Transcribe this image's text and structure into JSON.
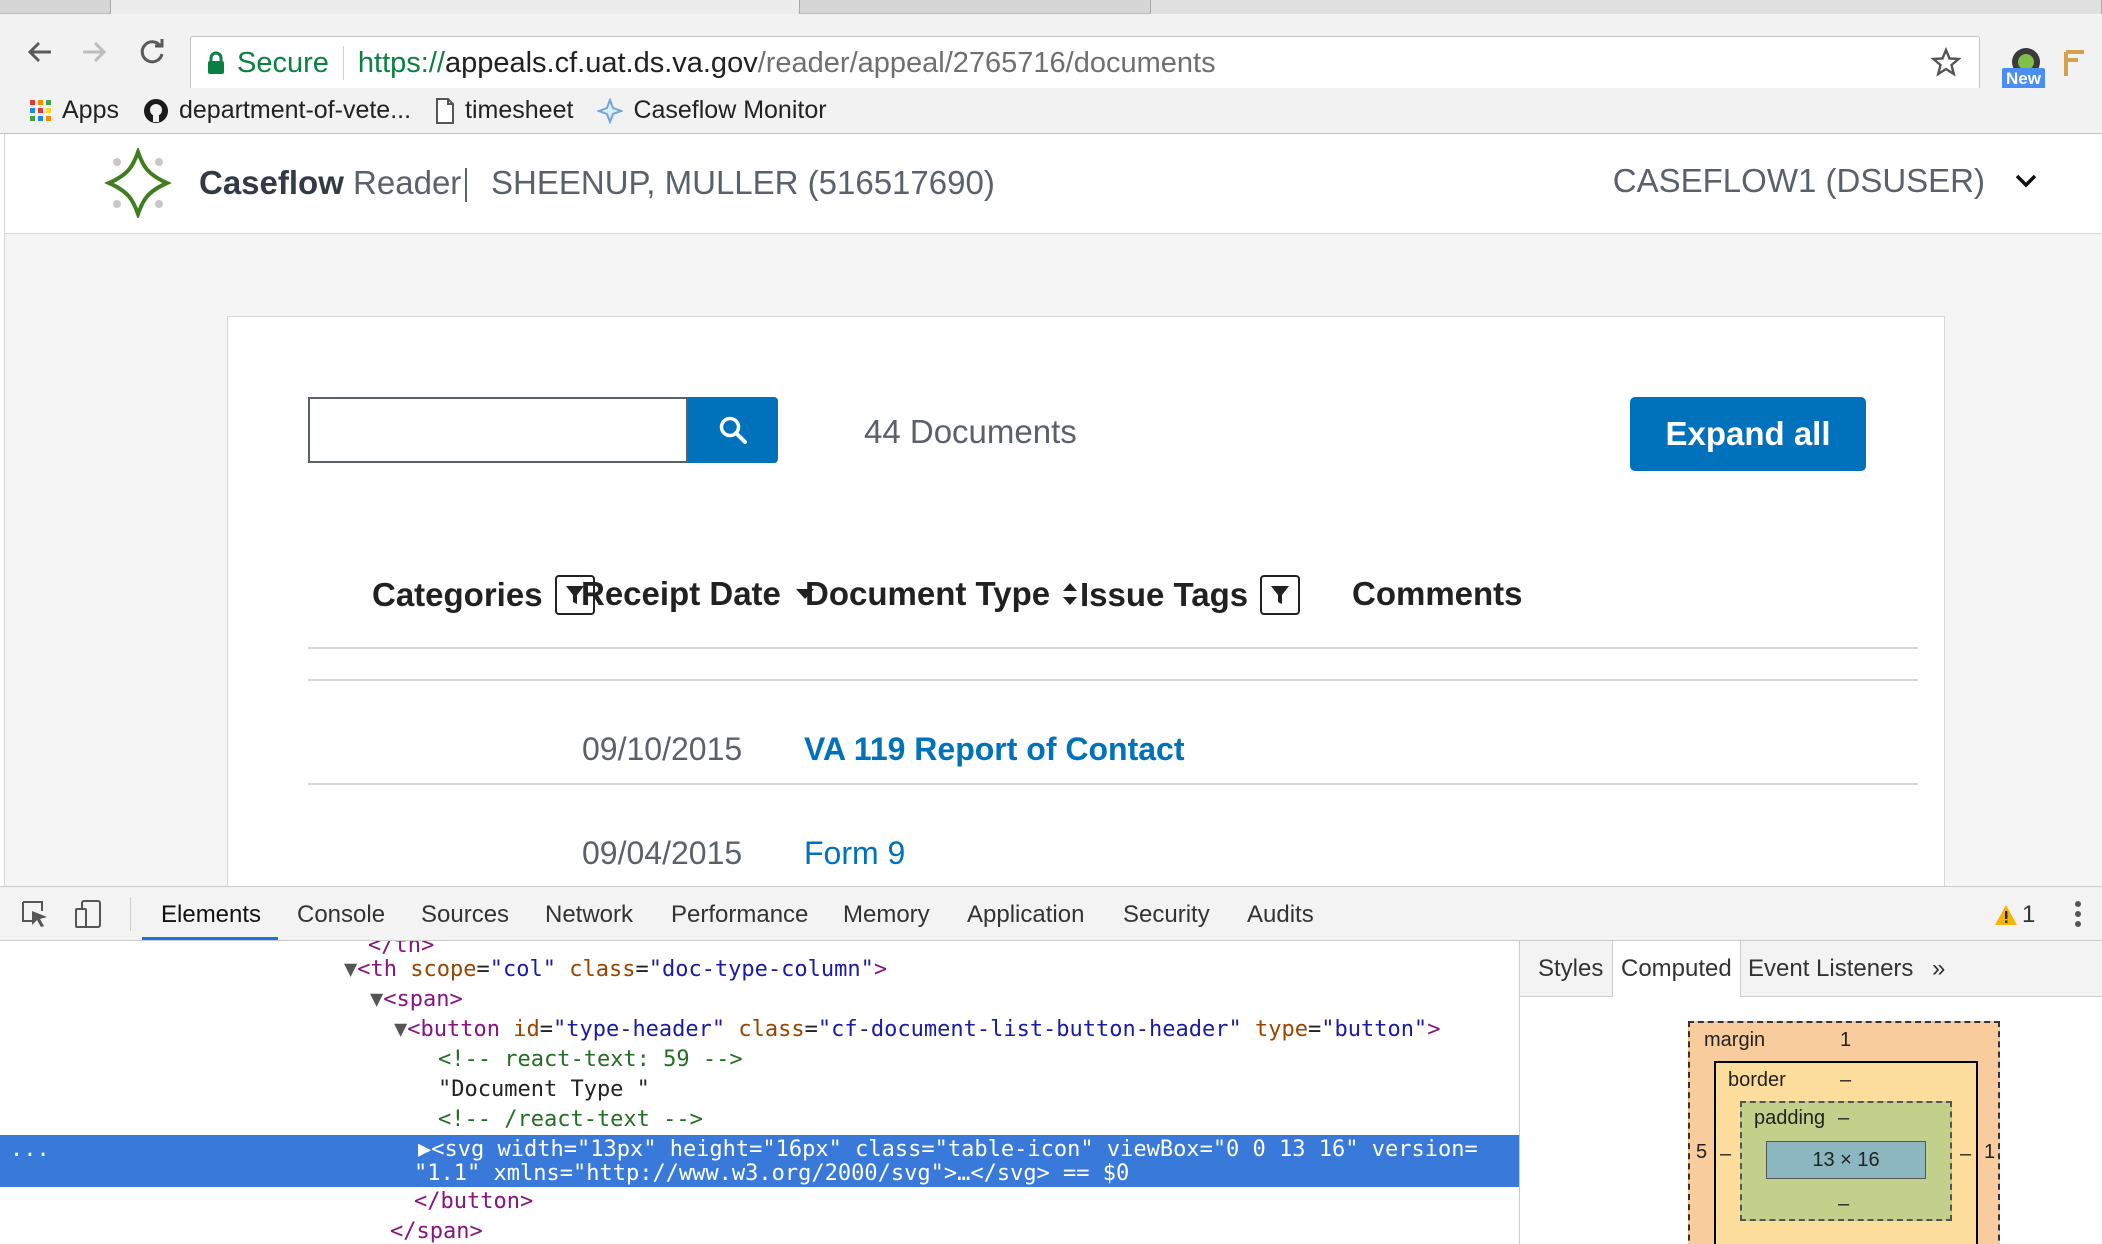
{
  "browser": {
    "address": {
      "secure_label": "Secure",
      "scheme": "https://",
      "host": "appeals.cf.uat.ds.va.gov",
      "path": "/reader/appeal/2765716/documents"
    },
    "extension_badge": "New",
    "bookmarks": [
      {
        "label": "Apps",
        "icon": "apps-grid-icon"
      },
      {
        "label": "department-of-vete...",
        "icon": "github-icon"
      },
      {
        "label": "timesheet",
        "icon": "page-icon"
      },
      {
        "label": "Caseflow Monitor",
        "icon": "caseflow-icon"
      }
    ]
  },
  "app": {
    "name_bold": "Caseflow",
    "name_light": "Reader",
    "veteran": "SHEENUP, MULLER (516517690)",
    "user": "CASEFLOW1 (DSUSER)"
  },
  "documents": {
    "count_label": "44 Documents",
    "expand_all_label": "Expand all",
    "columns": {
      "categories": "Categories",
      "receipt_date": "Receipt Date",
      "document_type": "Document Type",
      "issue_tags": "Issue Tags",
      "comments": "Comments"
    },
    "rows": [
      {
        "date": "09/10/2015",
        "type": "VA 119 Report of Contact",
        "bold": true
      },
      {
        "date": "09/04/2015",
        "type": "Form 9",
        "bold": false
      }
    ]
  },
  "devtools": {
    "tabs": [
      "Elements",
      "Console",
      "Sources",
      "Network",
      "Performance",
      "Memory",
      "Application",
      "Security",
      "Audits"
    ],
    "active_tab": "Elements",
    "warning_count": "1",
    "side_tabs": {
      "styles": "Styles",
      "computed": "Computed",
      "listeners": "Event Listeners",
      "more": "»"
    },
    "box_model": {
      "margin_label": "margin",
      "margin_top": "1",
      "margin_left": "5",
      "margin_right": "1",
      "border_label": "border",
      "border_top": "–",
      "padding_label": "padding",
      "padding_top": "–",
      "padding_bottom": "–",
      "border_bottom": "–",
      "side_dash": "–",
      "content": "13 × 16"
    },
    "dom": {
      "l0_close": "</th>",
      "l1": {
        "open": "<th",
        "a1": " scope",
        "v1": "\"col\"",
        "a2": " class",
        "v2": "\"doc-type-column\"",
        "close": ">"
      },
      "l2": "<span>",
      "l3": {
        "open": "<button",
        "a1": " id",
        "v1": "\"type-header\"",
        "a2": " class",
        "v2": "\"cf-document-list-button-header\"",
        "a3": " type",
        "v3": "\"button\"",
        "close": ">"
      },
      "l4": "<!-- react-text: 59 -->",
      "l5": "\"Document Type \"",
      "l6": "<!-- /react-text -->",
      "l7": {
        "open": "<svg",
        "a1": " width",
        "v1": "\"13px\"",
        "a2": " height",
        "v2": "\"16px\"",
        "a3": " class",
        "v3": "\"table-icon\"",
        "a4": " viewBox",
        "v4": "\"0 0 13 16\"",
        "a5": " version",
        "eq": "="
      },
      "l8": {
        "v5": "\"1.1\"",
        "a6": " xmlns",
        "v6": "\"http://www.w3.org/2000/svg\"",
        "rest": ">…</svg>",
        "marker": " == $0"
      },
      "l9": "</button>",
      "l10": "</span>",
      "ellipsis": "..."
    }
  }
}
